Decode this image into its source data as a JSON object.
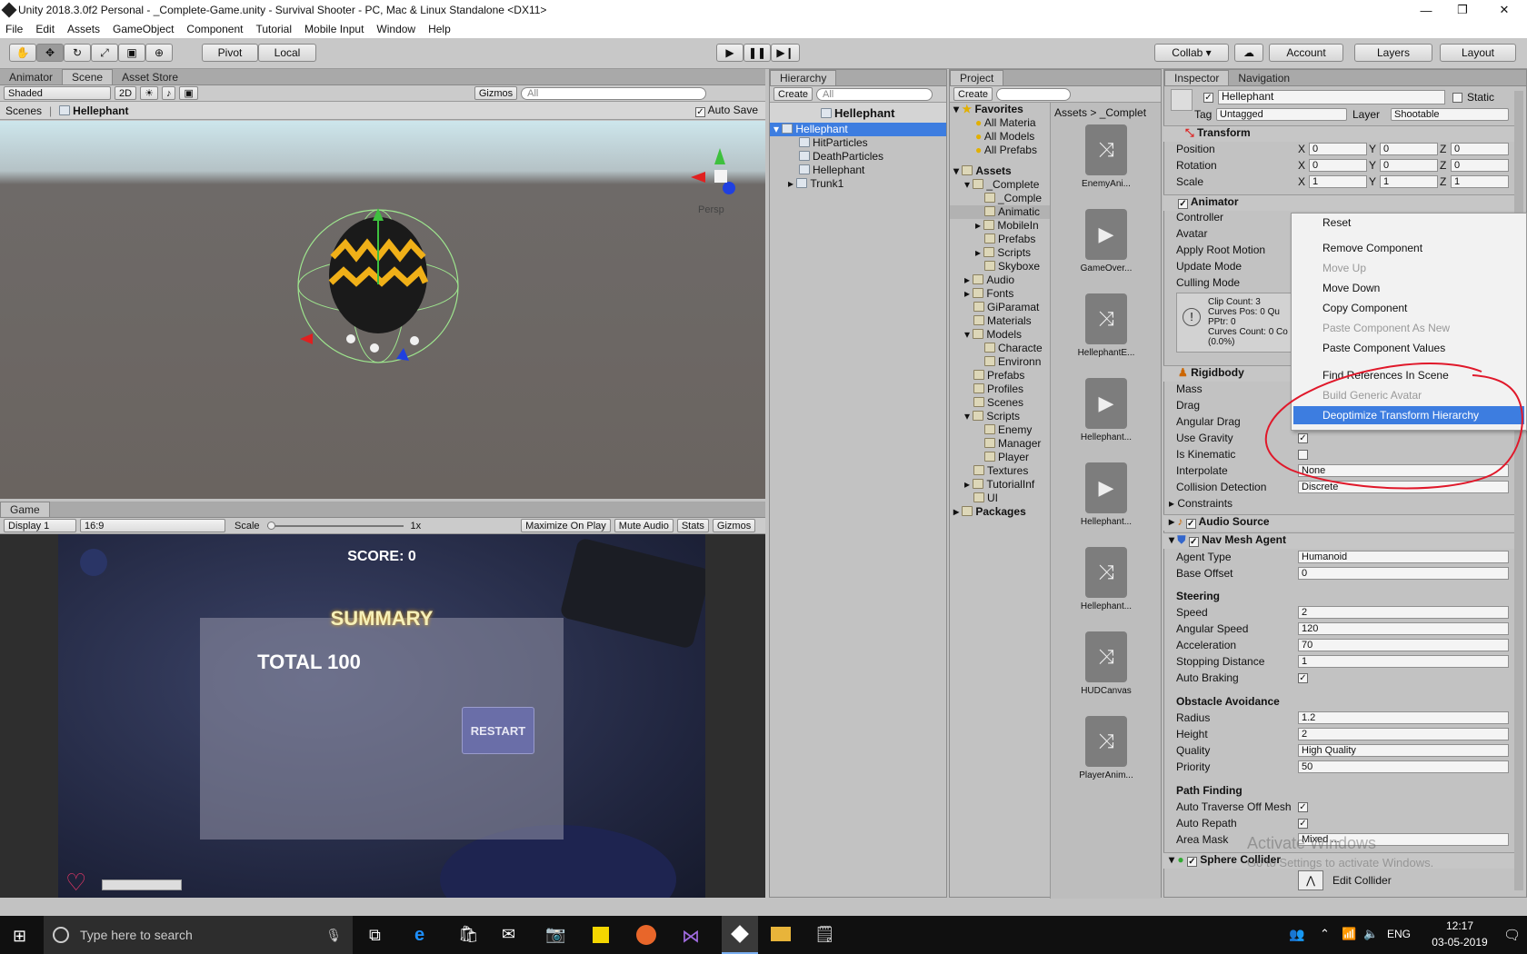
{
  "window": {
    "title": "Unity 2018.3.0f2 Personal - _Complete-Game.unity - Survival Shooter - PC, Mac & Linux Standalone <DX11>",
    "minimize": "—",
    "restore": "❐",
    "close": "✕"
  },
  "menu": [
    "File",
    "Edit",
    "Assets",
    "GameObject",
    "Component",
    "Tutorial",
    "Mobile Input",
    "Window",
    "Help"
  ],
  "toolbar": {
    "pivot": "Pivot",
    "local": "Local",
    "collab": "Collab ▾",
    "account": "Account",
    "layers": "Layers",
    "layout": "Layout"
  },
  "scene": {
    "tabs": [
      "Animator",
      "Scene",
      "Asset Store"
    ],
    "shading": "Shaded",
    "mode2d": "2D",
    "gizmos": "Gizmos",
    "search": "All",
    "scenes_label": "Scenes",
    "object": "Hellephant",
    "autosave": "Auto Save",
    "persp": "Persp"
  },
  "game": {
    "tab": "Game",
    "display": "Display 1",
    "aspect": "16:9",
    "scale_label": "Scale",
    "scale_value": "1x",
    "maximize": "Maximize On Play",
    "mute": "Mute Audio",
    "stats": "Stats",
    "gizmos": "Gizmos",
    "score": "SCORE: 0",
    "summary": "SUMMARY",
    "total": "TOTAL 100",
    "restart": "RESTART"
  },
  "hierarchy": {
    "tab": "Hierarchy",
    "create": "Create",
    "search": "All",
    "root": "Hellephant",
    "selected": "Hellephant",
    "children": [
      "HitParticles",
      "DeathParticles",
      "Hellephant",
      "Trunk1"
    ]
  },
  "project": {
    "tab": "Project",
    "create": "Create",
    "favorites": "Favorites",
    "fav_items": [
      "All Materia",
      "All Models",
      "All Prefabs"
    ],
    "assets": "Assets",
    "tree": [
      "_Complete",
      "_Comple",
      "Animatic",
      "MobileIn",
      "Prefabs",
      "Scripts",
      "Skyboxe",
      "Audio",
      "Fonts",
      "GiParamat",
      "Materials",
      "Models",
      "Characte",
      "Environn",
      "Prefabs",
      "Profiles",
      "Scenes",
      "Scripts",
      "Enemy",
      "Manager",
      "Player",
      "Textures",
      "TutorialInf",
      "UI"
    ],
    "packages": "Packages",
    "breadcrumb": "Assets  >  _Complet",
    "files": [
      "EnemyAni...",
      "GameOver...",
      "HellephantE...",
      "Hellephant...",
      "Hellephant...",
      "Hellephant...",
      "HUDCanvas",
      "PlayerAnim..."
    ]
  },
  "inspector": {
    "tab": "Inspector",
    "tab2": "Navigation",
    "name": "Hellephant",
    "static": "Static",
    "tag_label": "Tag",
    "tag": "Untagged",
    "layer_label": "Layer",
    "layer": "Shootable",
    "transform": "Transform",
    "position": "Position",
    "rotation": "Rotation",
    "scale": "Scale",
    "pos": [
      "0",
      "0",
      "0"
    ],
    "rot": [
      "0",
      "0",
      "0"
    ],
    "scl": [
      "1",
      "1",
      "1"
    ],
    "animator": "Animator",
    "controller": "Controller",
    "avatar": "Avatar",
    "apply_root": "Apply Root Motion",
    "update_mode": "Update Mode",
    "culling": "Culling Mode",
    "info": [
      "Clip Count: 3",
      "Curves Pos: 0 Qu",
      "PPtr: 0",
      "Curves Count: 0 Co",
      "(0.0%)"
    ],
    "rigidbody": "Rigidbody",
    "mass": "Mass",
    "drag": "Drag",
    "angdrag": "Angular Drag",
    "gravity": "Use Gravity",
    "kinematic": "Is Kinematic",
    "interpolate": "Interpolate",
    "interp_val": "None",
    "collision": "Collision Detection",
    "collision_val": "Discrete",
    "constraints": "Constraints",
    "audio": "Audio Source",
    "nav": "Nav Mesh Agent",
    "agent_type": "Agent Type",
    "agent_val": "Humanoid",
    "base_offset": "Base Offset",
    "base_val": "0",
    "steering": "Steering",
    "speed": "Speed",
    "speed_val": "2",
    "angspeed": "Angular Speed",
    "angspeed_val": "120",
    "accel": "Acceleration",
    "accel_val": "70",
    "stopdist": "Stopping Distance",
    "stopdist_val": "1",
    "autobrake": "Auto Braking",
    "obstacle": "Obstacle Avoidance",
    "radius": "Radius",
    "radius_val": "1.2",
    "height": "Height",
    "height_val": "2",
    "quality": "Quality",
    "quality_val": "High Quality",
    "priority": "Priority",
    "priority_val": "50",
    "pathfinding": "Path Finding",
    "autotraverse": "Auto Traverse Off Mesh",
    "autorepath": "Auto Repath",
    "areamask": "Area Mask",
    "areamask_val": "Mixed ...",
    "sphere": "Sphere Collider",
    "edit_collider": "Edit Collider",
    "watermark1": "Activate Windows",
    "watermark2": "Go to Settings to activate Windows."
  },
  "context_menu": {
    "items": [
      "Reset",
      "Remove Component",
      "Move Up",
      "Move Down",
      "Copy Component",
      "Paste Component As New",
      "Paste Component Values",
      "Find References In Scene",
      "Build Generic Avatar",
      "Deoptimize Transform Hierarchy"
    ]
  },
  "taskbar": {
    "search": "Type here to search",
    "lang": "ENG",
    "time": "12:17",
    "date": "03-05-2019"
  },
  "colors": {
    "selection": "#3d7de0",
    "annotation": "#e0182a"
  }
}
